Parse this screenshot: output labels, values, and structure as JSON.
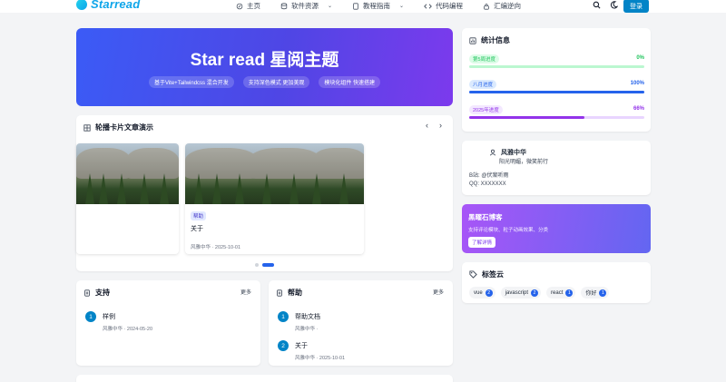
{
  "header": {
    "logo_text": "Starread",
    "nav": [
      {
        "label": "主页",
        "has_dropdown": false
      },
      {
        "label": "软件资源",
        "has_dropdown": true
      },
      {
        "label": "教程指南",
        "has_dropdown": true
      },
      {
        "label": "代码编程",
        "has_dropdown": false
      },
      {
        "label": "汇编逆向",
        "has_dropdown": false
      }
    ],
    "login_label": "登录"
  },
  "hero": {
    "title": "Star read 星阅主题",
    "tags": [
      "基于Vite+Tailwindcss 混合开发",
      "支持深色模式 更加美观",
      "模块化组件 快速搭建"
    ]
  },
  "carousel": {
    "title": "轮播卡片文章演示",
    "slides": [
      {
        "tag": "",
        "title": "",
        "meta": ""
      },
      {
        "tag": "帮助",
        "title": "关于",
        "meta": "风雅中华 · 2025-10-01"
      }
    ]
  },
  "support": {
    "title": "支持",
    "more": "更多",
    "items": [
      {
        "num": "1",
        "title": "样例",
        "meta": "风雅中华 · 2024-05-20"
      }
    ]
  },
  "help": {
    "title": "帮助",
    "more": "更多",
    "items": [
      {
        "num": "1",
        "title": "帮助文档",
        "meta": "风雅中华 ·"
      },
      {
        "num": "2",
        "title": "关于",
        "meta": "风雅中华 · 2025-10-01"
      }
    ]
  },
  "stats": {
    "title": "统计信息",
    "rows": [
      {
        "label": "第5周进度",
        "pct_text": "0%",
        "value": 0,
        "color": "#22c55e",
        "pill_bg": "#dcfce7",
        "track": "#bbf7d0"
      },
      {
        "label": "八月进度",
        "pct_text": "100%",
        "value": 100,
        "color": "#2563eb",
        "pill_bg": "#dbeafe",
        "track": "#bfdbfe"
      },
      {
        "label": "2025年进度",
        "pct_text": "66%",
        "value": 66,
        "color": "#9333ea",
        "pill_bg": "#f3e8ff",
        "track": "#e9d5ff"
      }
    ]
  },
  "profile": {
    "name": "风雅中华",
    "motto": "阳光明媚，微笑前行",
    "site": "B站: @伏案听雨",
    "qq": "QQ: XXXXXXX"
  },
  "promo": {
    "title": "黑曜石博客",
    "desc": "支持评论模块、粒子动画效果、分类",
    "button": "了解详情"
  },
  "tag_cloud": {
    "title": "标签云",
    "tags": [
      {
        "name": "vue",
        "count": "2"
      },
      {
        "name": "javascript",
        "count": "2"
      },
      {
        "name": "react",
        "count": "1"
      },
      {
        "name": "你好",
        "count": "1"
      }
    ]
  }
}
